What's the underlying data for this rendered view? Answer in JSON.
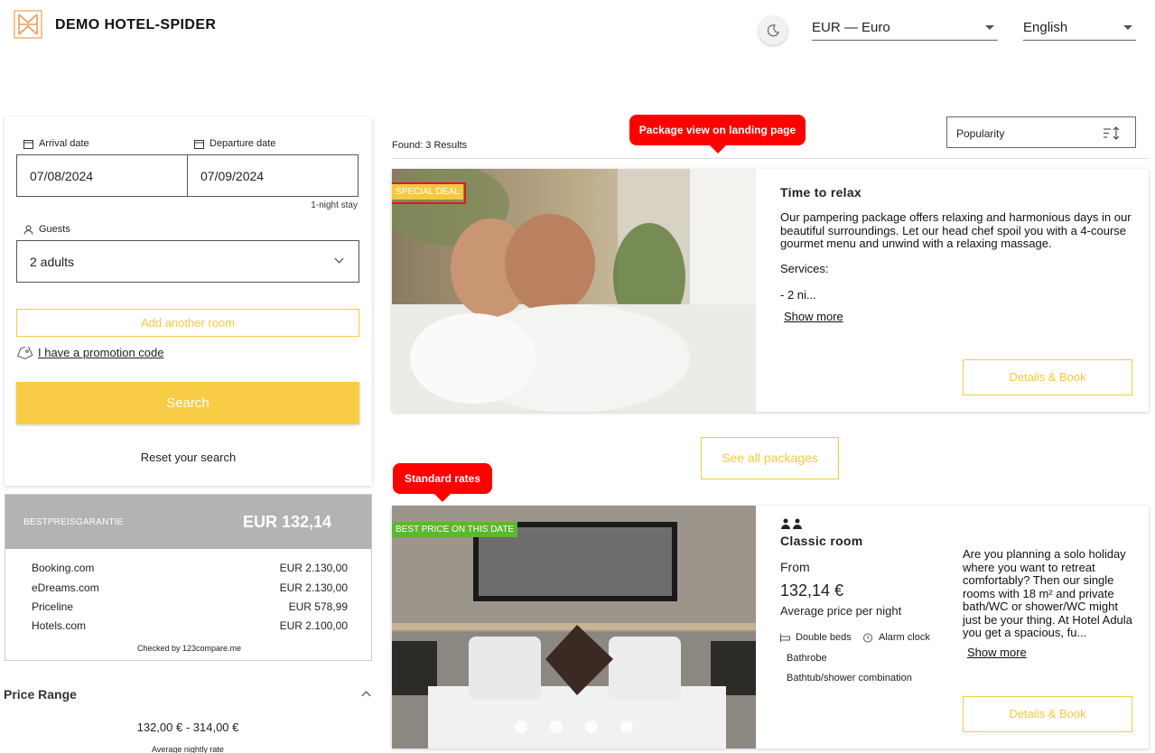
{
  "header": {
    "brand": "DEMO HOTEL-SPIDER",
    "currency": "EUR — Euro",
    "language": "English"
  },
  "search": {
    "arrival_label": "Arrival date",
    "departure_label": "Departure date",
    "arrival_value": "07/08/2024",
    "departure_value": "07/09/2024",
    "nights": "1-night stay",
    "guests_label": "Guests",
    "guests_value": "2 adults",
    "add_room": "Add another room",
    "promo": "I have a promotion code",
    "search_button": "Search",
    "reset": "Reset your search"
  },
  "best_price": {
    "title": "BESTPREISGARANTIE",
    "price": "EUR 132,14",
    "rows": [
      {
        "site": "Booking.com",
        "price": "EUR 2.130,00"
      },
      {
        "site": "eDreams.com",
        "price": "EUR 2.130,00"
      },
      {
        "site": "Priceline",
        "price": "EUR 578,99"
      },
      {
        "site": "Hotels.com",
        "price": "EUR 2.100,00"
      }
    ],
    "checked": "Checked by 123compare.me"
  },
  "price_range": {
    "title": "Price Range",
    "values": "132,00 € -  314,00 €",
    "sub": "Average nightly rate"
  },
  "results": {
    "found": "Found: 3 Results",
    "sort_value": "Popularity"
  },
  "callouts": {
    "package": "Package view on landing page",
    "standard": "Standard rates"
  },
  "package": {
    "badge": "SPECIAL DEAL",
    "title": "Time to relax",
    "desc1": "Our pampering package offers relaxing and harmonious days in our beautiful surroundings. Let our head chef spoil you with a 4-course gourmet menu and unwind with a relaxing massage.",
    "desc2": "Services:",
    "desc3": "- 2 ni...",
    "show_more": "Show more",
    "book": "Details & Book"
  },
  "see_all": "See all packages",
  "room": {
    "badge": "BEST PRICE ON THIS DATE",
    "title": "Classic room",
    "from": "From",
    "price": "132,14 €",
    "price_note": "Average price per night",
    "amenities": [
      "Double beds",
      "Alarm clock",
      "Bathrobe",
      "Bathtub/shower combination"
    ],
    "desc": "Are you planning a solo holiday where you want to retreat comfortably? Then our single rooms with 18 m² and private bath/WC or shower/WC might just be your thing. At Hotel Adula you get a spacious, fu...",
    "show_more": "Show more",
    "book": "Details & Book"
  },
  "colors": {
    "accent": "#f8cc45",
    "badge_deal": "#f5c842",
    "badge_best": "#5cb82e",
    "callout": "#ff0000"
  }
}
